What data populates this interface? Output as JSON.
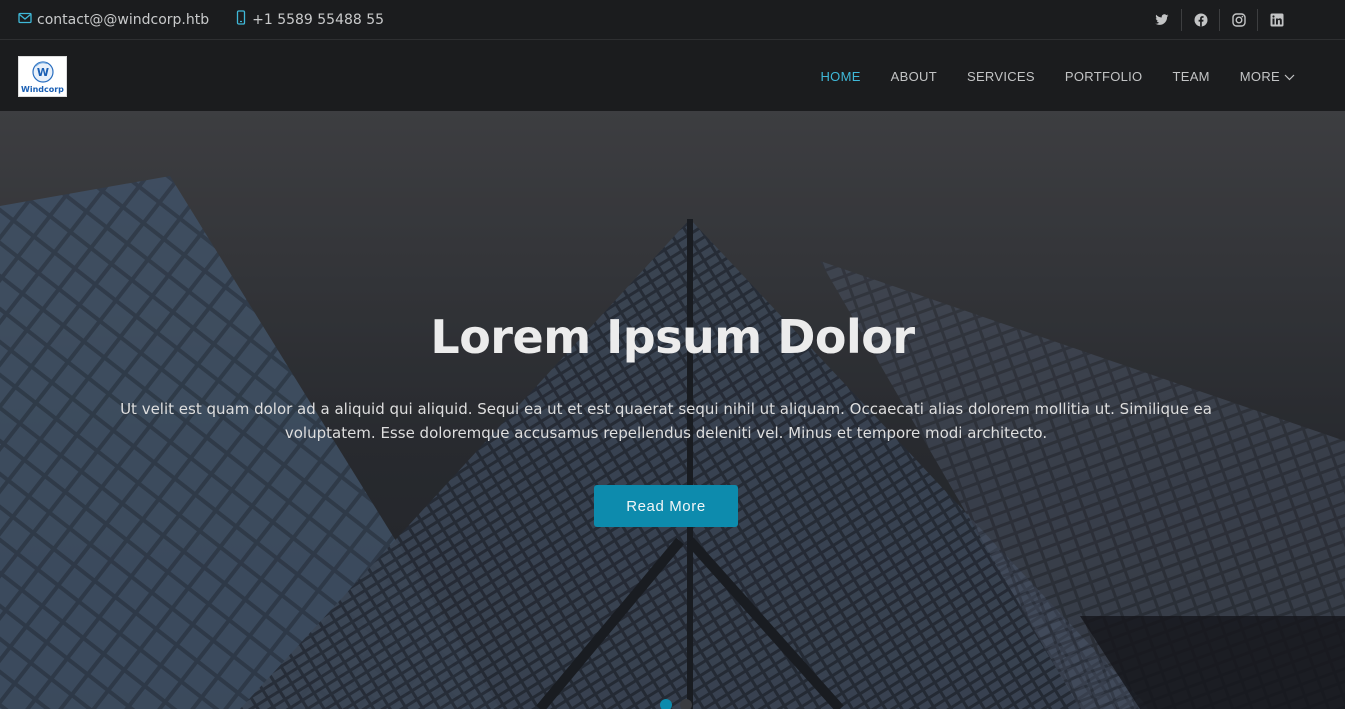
{
  "topbar": {
    "email": "contact@@windcorp.htb",
    "phone": "+1 5589 55488 55",
    "social_icons": [
      "twitter-icon",
      "facebook-icon",
      "instagram-icon",
      "linkedin-icon"
    ]
  },
  "header": {
    "logo_text": "Windcorp",
    "logo_letter": "W",
    "nav": [
      {
        "label": "HOME",
        "active": true
      },
      {
        "label": "ABOUT",
        "active": false
      },
      {
        "label": "SERVICES",
        "active": false
      },
      {
        "label": "PORTFOLIO",
        "active": false
      },
      {
        "label": "TEAM",
        "active": false
      },
      {
        "label": "MORE",
        "active": false
      }
    ]
  },
  "hero": {
    "title": "Lorem Ipsum Dolor",
    "text": "Ut velit est quam dolor ad a aliquid qui aliquid. Sequi ea ut et est quaerat sequi nihil ut aliquam. Occaecati alias dolorem mollitia ut. Similique ea voluptatem. Esse doloremque accusamus repellendus deleniti vel. Minus et tempore modi architecto.",
    "button": "Read More",
    "carousel_active": 1
  },
  "colors": {
    "accent": "#3fb8d8",
    "button": "#0d8bad",
    "background": "#1b1c1e"
  }
}
